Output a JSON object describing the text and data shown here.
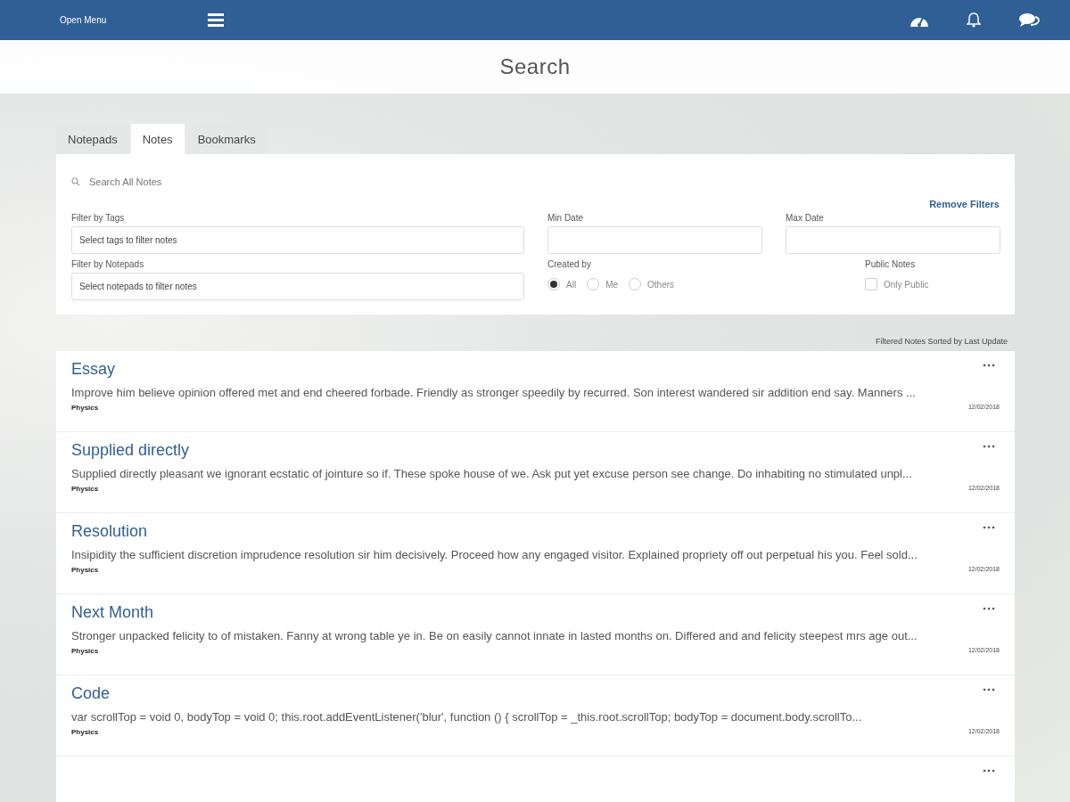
{
  "topbar": {
    "menu_label": "Open Menu"
  },
  "page_title": "Search",
  "tabs": [
    {
      "label": "Notepads",
      "selected": false
    },
    {
      "label": "Notes",
      "selected": true
    },
    {
      "label": "Bookmarks",
      "selected": false
    }
  ],
  "filters": {
    "search": {
      "placeholder": "Search All Notes"
    },
    "remove_filters": "Remove Filters",
    "tags": {
      "label": "Filter by Tags",
      "placeholder": "Select tags to filter notes"
    },
    "notepads": {
      "label": "Filter by Notepads",
      "placeholder": "Select notepads to filter notes"
    },
    "min_date": {
      "label": "Min Date"
    },
    "max_date": {
      "label": "Max Date"
    },
    "created_by": {
      "label": "Created by",
      "options": [
        {
          "label": "All",
          "selected": true
        },
        {
          "label": "Me",
          "selected": false
        },
        {
          "label": "Others",
          "selected": false
        }
      ]
    },
    "public_notes": {
      "label": "Public Notes",
      "option": "Only Public",
      "checked": false
    }
  },
  "sort_caption": "Filtered Notes Sorted by Last Update",
  "notes": [
    {
      "title": "Essay",
      "excerpt": "Improve him believe opinion offered met and end cheered forbade. Friendly as stronger speedily by recurred. Son interest wandered sir addition end say. Manners ...",
      "tag": "Physics",
      "date": "12/02/2018"
    },
    {
      "title": "Supplied directly",
      "excerpt": "Supplied directly pleasant we ignorant ecstatic of jointure so if. These spoke house of we. Ask put yet excuse person see change. Do inhabiting no stimulated unpl...",
      "tag": "Physics",
      "date": "12/02/2018"
    },
    {
      "title": "Resolution",
      "excerpt": "Insipidity the sufficient discretion imprudence resolution sir him decisively. Proceed how any engaged visitor. Explained propriety off out perpetual his you. Feel sold...",
      "tag": "Physics",
      "date": "12/02/2018"
    },
    {
      "title": "Next Month",
      "excerpt": "Stronger unpacked felicity to of mistaken. Fanny at wrong table ye in. Be on easily cannot innate in lasted months on. Differed and and felicity steepest mrs age out...",
      "tag": "Physics",
      "date": "12/02/2018"
    },
    {
      "title": "Code",
      "excerpt": "var scrollTop = void 0, bodyTop = void 0; this.root.addEventListener('blur', function () { scrollTop = _this.root.scrollTop; bodyTop = document.body.scrollTo...",
      "tag": "Physics",
      "date": "12/02/2018"
    }
  ]
}
